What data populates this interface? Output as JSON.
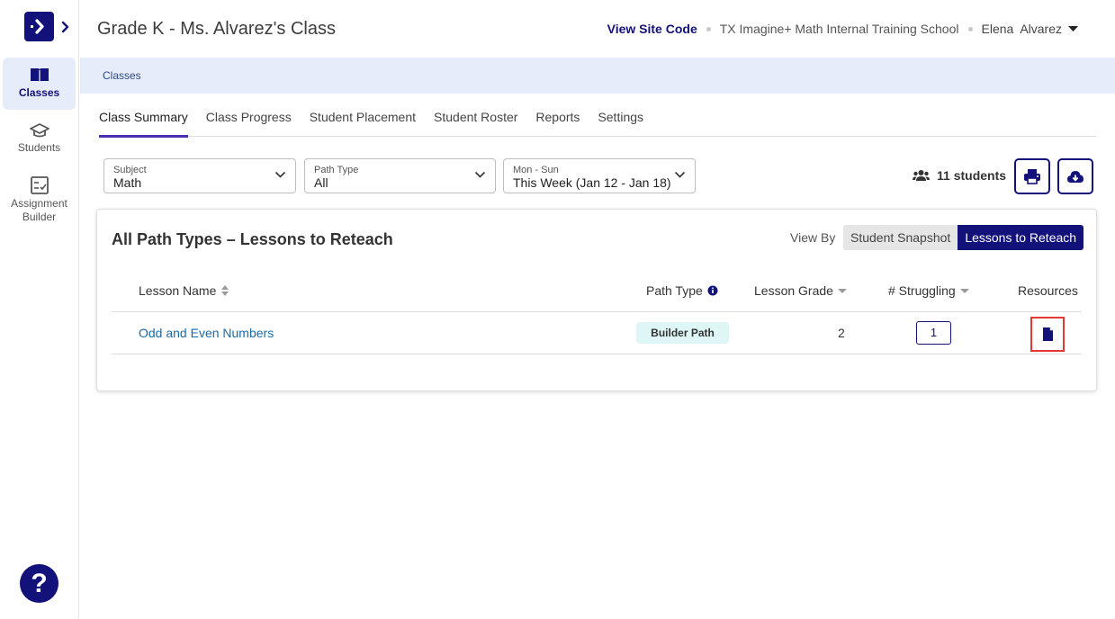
{
  "header": {
    "title": "Grade K - Ms. Alvarez's Class",
    "site_code_label": "View Site Code",
    "school": "TX Imagine+ Math Internal Training School",
    "user_first": "Elena",
    "user_last": "Alvarez"
  },
  "sidebar": {
    "items": [
      {
        "label": "Classes",
        "icon": "open-book-icon",
        "active": true
      },
      {
        "label": "Students",
        "icon": "graduation-cap-icon",
        "active": false
      },
      {
        "label": "Assignment Builder",
        "icon": "checklist-icon",
        "active": false
      }
    ],
    "help_label": "?"
  },
  "breadcrumb": "Classes",
  "tabs": [
    {
      "label": "Class Summary",
      "active": true
    },
    {
      "label": "Class Progress",
      "active": false
    },
    {
      "label": "Student Placement",
      "active": false
    },
    {
      "label": "Student Roster",
      "active": false
    },
    {
      "label": "Reports",
      "active": false
    },
    {
      "label": "Settings",
      "active": false
    }
  ],
  "filters": {
    "subject": {
      "label": "Subject",
      "value": "Math"
    },
    "path_type": {
      "label": "Path Type",
      "value": "All"
    },
    "week": {
      "label": "Mon - Sun",
      "value": "This Week (Jan 12 - Jan 18)"
    }
  },
  "students_count": "11 students",
  "card": {
    "title": "All Path Types – Lessons to Reteach",
    "view_by_label": "View By",
    "view_options": [
      "Student Snapshot",
      "Lessons to Reteach"
    ],
    "selected_view": "Lessons to Reteach",
    "columns": {
      "lesson_name": "Lesson Name",
      "path_type": "Path Type",
      "lesson_grade": "Lesson Grade",
      "struggling": "# Struggling",
      "resources": "Resources"
    },
    "rows": [
      {
        "lesson_name": "Odd and Even Numbers",
        "path_type": "Builder Path",
        "lesson_grade": "2",
        "struggling": "1"
      }
    ]
  },
  "colors": {
    "brand_navy": "#12127a",
    "tab_underline": "#4a2fb5",
    "breadcrumb_bg": "#e7ecfb",
    "link": "#1b6aa8",
    "badge_bg": "#dff6f6",
    "highlight_border": "#e53935"
  }
}
